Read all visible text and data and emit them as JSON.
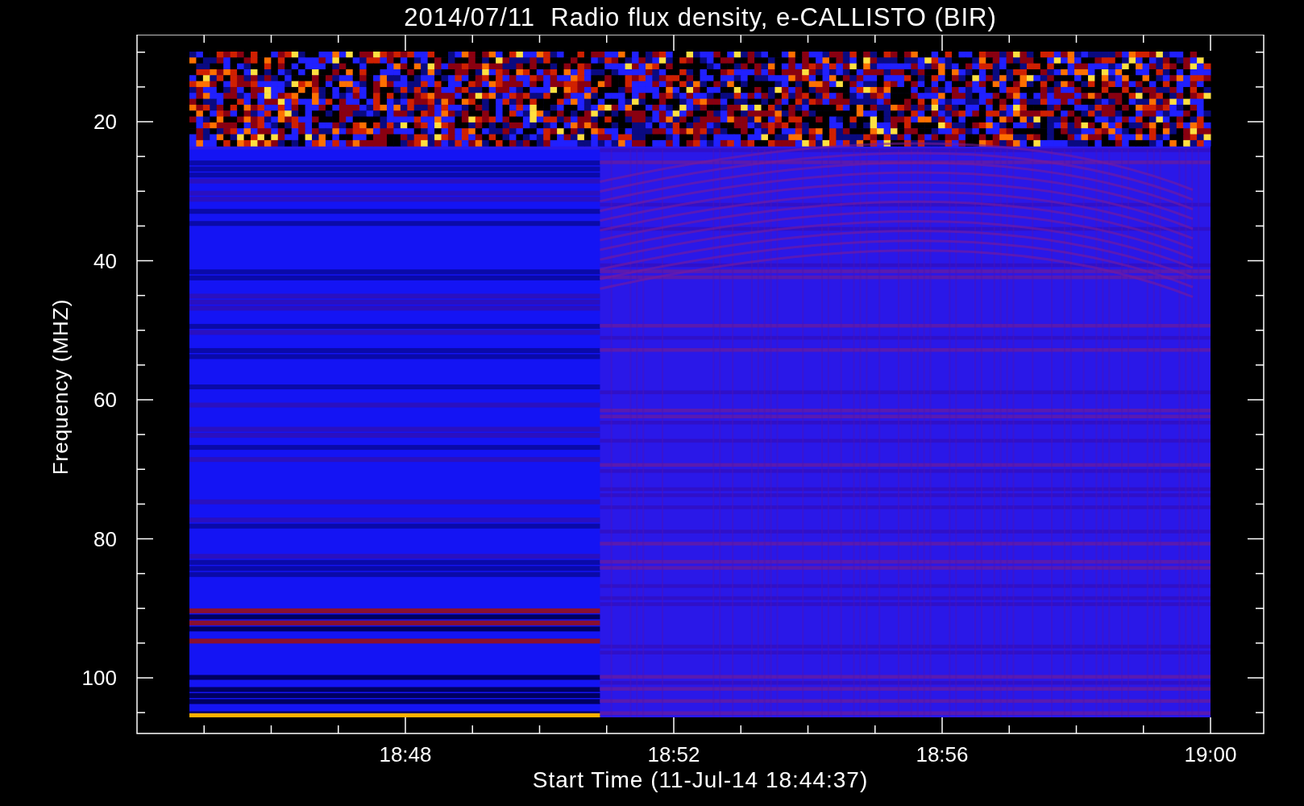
{
  "title": "2014/07/11  Radio flux density, e-CALLISTO (BIR)",
  "y_axis": {
    "label": "Frequency (MHZ)",
    "ticks": [
      "20",
      "40",
      "60",
      "80",
      "100"
    ]
  },
  "x_axis": {
    "label": "Start Time (11-Jul-14 18:44:37)",
    "ticks": [
      "18:48",
      "18:52",
      "18:56",
      "19:00"
    ]
  }
}
